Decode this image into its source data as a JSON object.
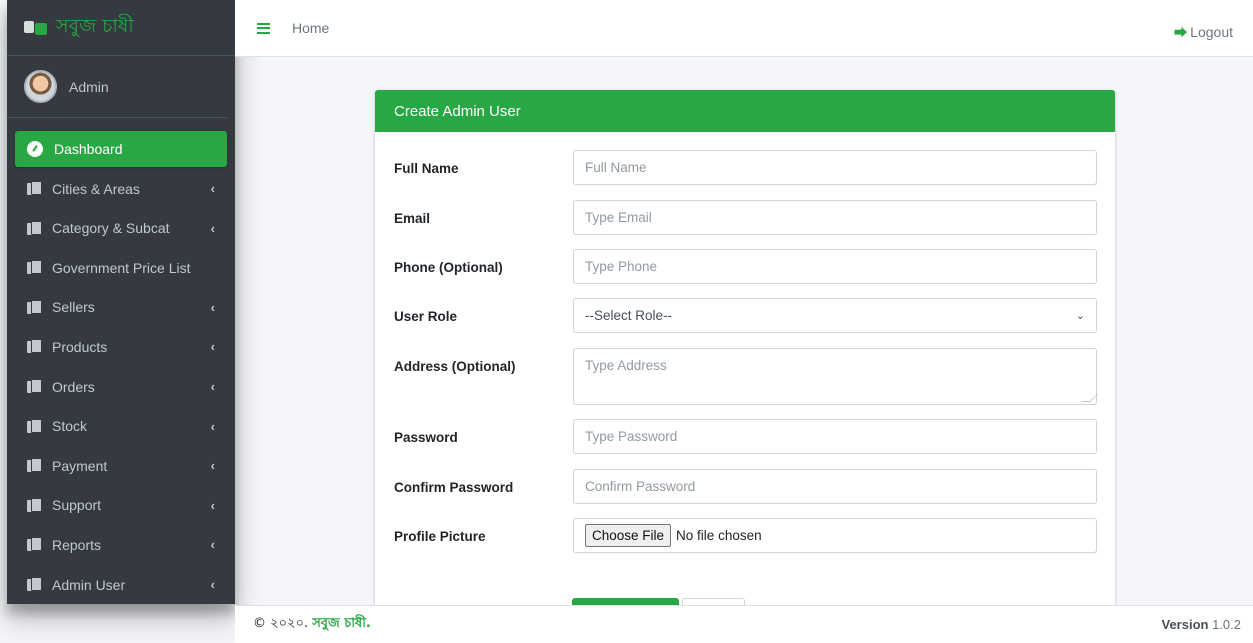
{
  "brand": {
    "name": "সবুজ চাষী"
  },
  "user": {
    "name": "Admin"
  },
  "sidebar": {
    "items": [
      {
        "label": "Dashboard",
        "active": true,
        "chevron": false
      },
      {
        "label": "Cities & Areas",
        "chevron": true
      },
      {
        "label": "Category & Subcat",
        "chevron": true
      },
      {
        "label": "Government Price List",
        "chevron": false
      },
      {
        "label": "Sellers",
        "chevron": true
      },
      {
        "label": "Products",
        "chevron": true
      },
      {
        "label": "Orders",
        "chevron": true
      },
      {
        "label": "Stock",
        "chevron": true
      },
      {
        "label": "Payment",
        "chevron": true
      },
      {
        "label": "Support",
        "chevron": true
      },
      {
        "label": "Reports",
        "chevron": true
      },
      {
        "label": "Admin User",
        "chevron": true
      }
    ],
    "chevron_glyph": "‹"
  },
  "header": {
    "home": "Home",
    "logout": "Logout"
  },
  "form": {
    "title": "Create Admin User",
    "full_name": {
      "label": "Full Name",
      "placeholder": "Full Name"
    },
    "email": {
      "label": "Email",
      "placeholder": "Type Email"
    },
    "phone": {
      "label": "Phone (Optional)",
      "placeholder": "Type Phone"
    },
    "role": {
      "label": "User Role",
      "selected": "--Select Role--"
    },
    "address": {
      "label": "Address (Optional)",
      "placeholder": "Type Address"
    },
    "password": {
      "label": "Password",
      "placeholder": "Type Password"
    },
    "confirm": {
      "label": "Confirm Password",
      "placeholder": "Confirm Password"
    },
    "picture": {
      "label": "Profile Picture",
      "button": "Choose File",
      "status": "No file chosen"
    }
  },
  "footer": {
    "copyright_prefix": "© ২০২০.",
    "brand": "সবুজ চাষী.",
    "version_label": "Version",
    "version": "1.0.2"
  },
  "colors": {
    "accent": "#28a745",
    "sidebar": "#343a40"
  }
}
